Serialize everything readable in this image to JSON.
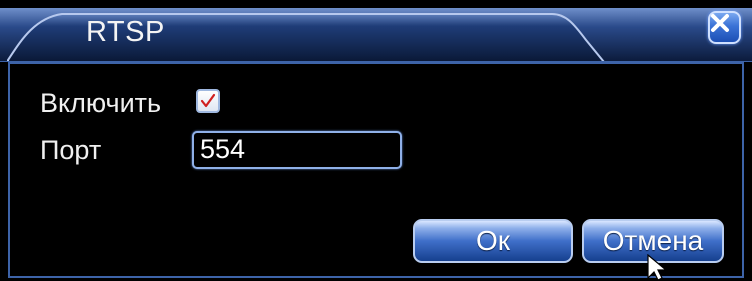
{
  "dialog": {
    "title": "RTSP",
    "close_icon": "close-x-icon",
    "accent_color": "#3d63a8"
  },
  "form": {
    "enable_label": "Включить",
    "enable_checked": true,
    "port_label": "Порт",
    "port_value": "554"
  },
  "buttons": {
    "ok_label": "Ок",
    "cancel_label": "Отмена"
  },
  "pointer": {
    "icon": "mouse-pointer-icon"
  }
}
